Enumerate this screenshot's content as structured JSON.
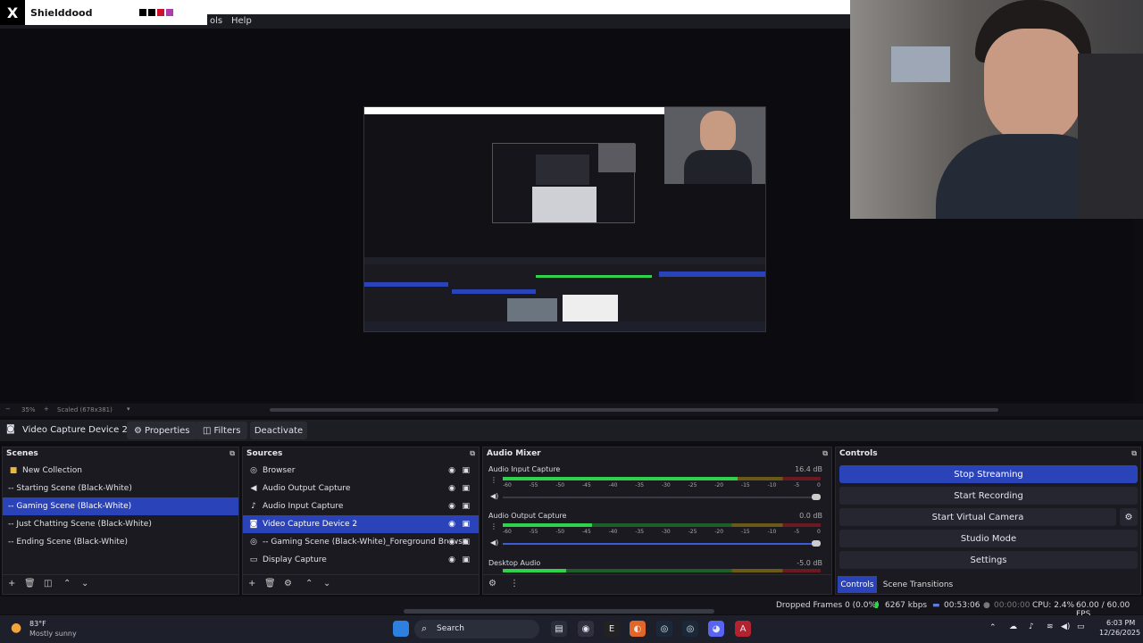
{
  "overlay": {
    "app_name": "Shielddood",
    "swatches": [
      "#000000",
      "#000000",
      "#cc1133",
      "#b03ab0"
    ]
  },
  "menu": {
    "partial": "ols",
    "help": "Help"
  },
  "zoom": {
    "level": "35%",
    "scaled": "Scaled (678x381)"
  },
  "source_toolbar": {
    "selected": "Video Capture Device 2",
    "properties": "Properties",
    "filters": "Filters",
    "deactivate": "Deactivate"
  },
  "scenes": {
    "title": "Scenes",
    "items": [
      {
        "label": "New Collection",
        "icon": "folder-icon"
      },
      {
        "label": "-- Starting Scene (Black-White)"
      },
      {
        "label": "-- Gaming Scene (Black-White)",
        "selected": true
      },
      {
        "label": "-- Just Chatting Scene (Black-White)"
      },
      {
        "label": "-- Ending Scene (Black-White)"
      }
    ]
  },
  "sources": {
    "title": "Sources",
    "items": [
      {
        "label": "Browser",
        "icon": "globe-icon"
      },
      {
        "label": "Audio Output Capture",
        "icon": "speaker-icon"
      },
      {
        "label": "Audio Input Capture",
        "icon": "mic-icon"
      },
      {
        "label": "Video Capture Device 2",
        "icon": "camera-icon",
        "selected": true
      },
      {
        "label": "-- Gaming Scene (Black-White)_Foreground Browse",
        "icon": "globe-icon"
      },
      {
        "label": "Display Capture",
        "icon": "monitor-icon"
      }
    ]
  },
  "mixer": {
    "title": "Audio Mixer",
    "channels": [
      {
        "name": "Audio Input Capture",
        "db": "16.4 dB",
        "level": 0.74
      },
      {
        "name": "Audio Output Capture",
        "db": "0.0 dB",
        "level": 0.28
      },
      {
        "name": "Desktop Audio",
        "db": "-5.0 dB",
        "level": 0.2
      }
    ],
    "ticks": [
      "-60",
      "-55",
      "-50",
      "-45",
      "-40",
      "-35",
      "-30",
      "-25",
      "-20",
      "-15",
      "-10",
      "-5",
      "0"
    ]
  },
  "controls": {
    "title": "Controls",
    "stop_streaming": "Stop Streaming",
    "start_recording": "Start Recording",
    "start_virtual_camera": "Start Virtual Camera",
    "studio_mode": "Studio Mode",
    "settings": "Settings",
    "tab_controls": "Controls",
    "tab_transitions": "Scene Transitions"
  },
  "status": {
    "dropped": "Dropped Frames 0 (0.0%)",
    "bitrate": "6267 kbps",
    "stream_time": "00:53:06",
    "rec_time": "00:00:00",
    "cpu": "CPU: 2.4%",
    "fps": "60.00 / 60.00 FPS"
  },
  "taskbar": {
    "temp": "83°F",
    "weather": "Mostly sunny",
    "search": "Search",
    "time": "6:03 PM",
    "date": "12/26/2025"
  }
}
